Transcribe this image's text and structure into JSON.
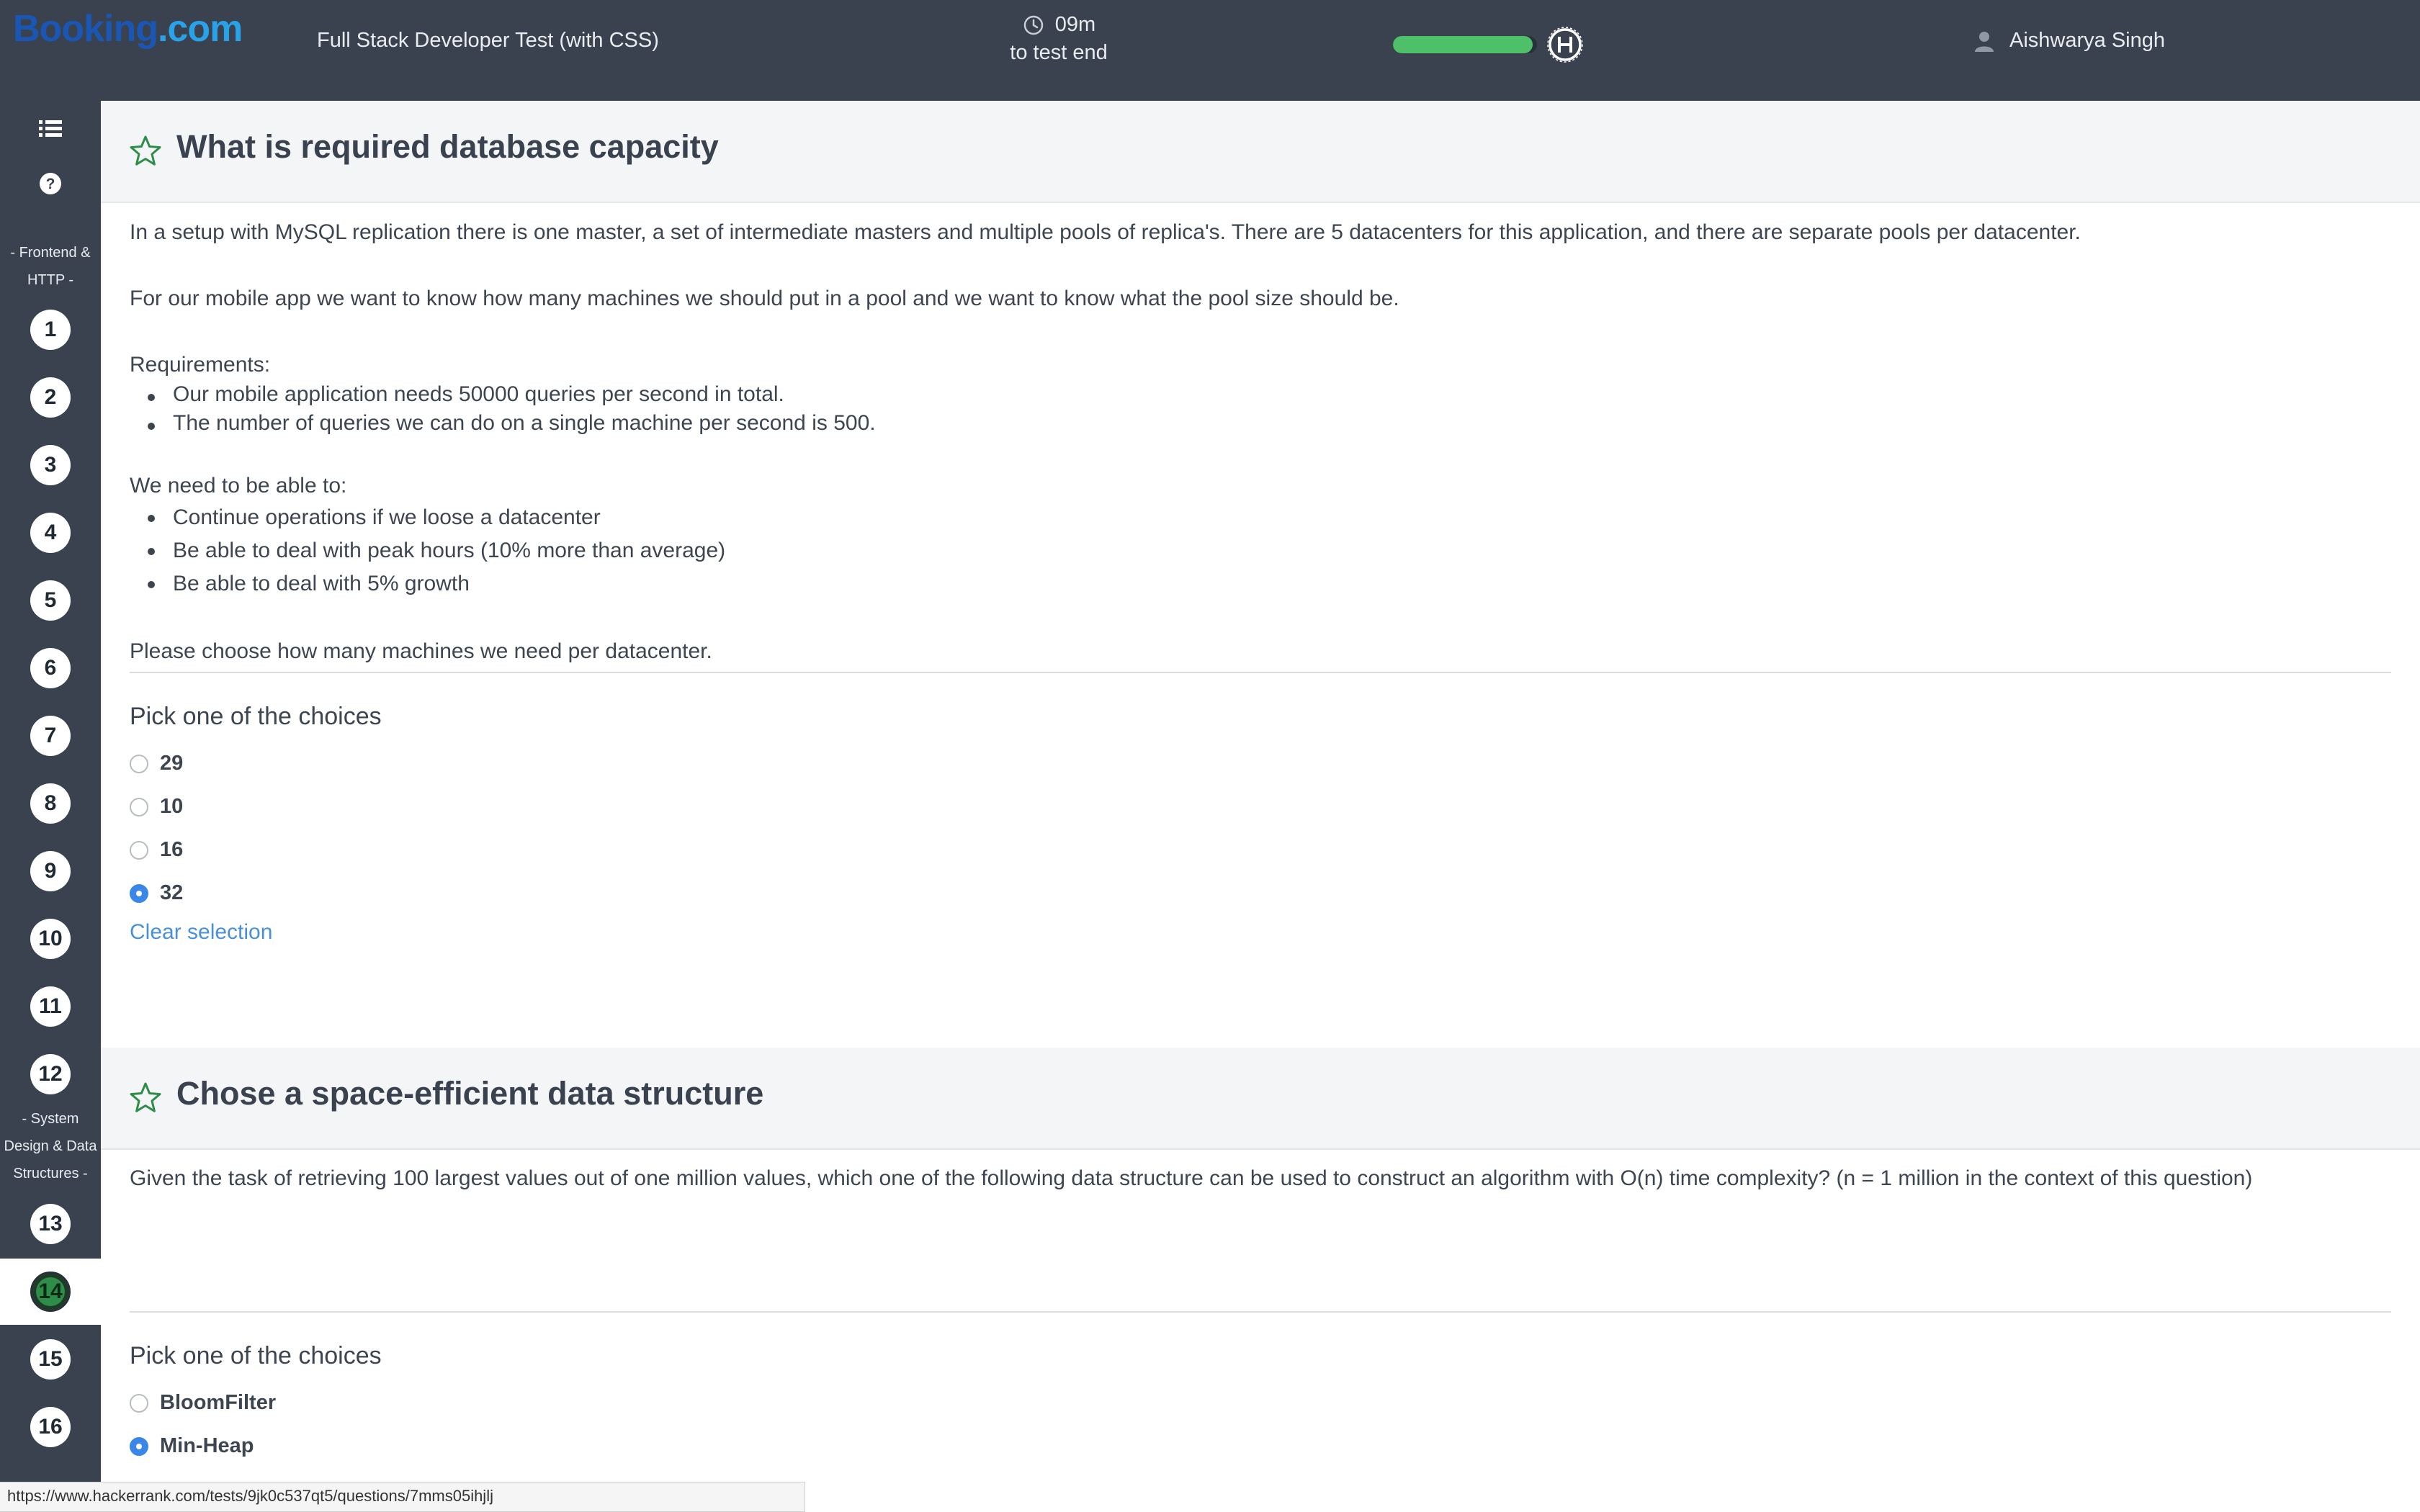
{
  "header": {
    "logo_main": "Booking",
    "logo_tld": ".com",
    "test_title": "Full Stack Developer Test (with CSS)",
    "timer_value": "09m",
    "timer_sub": "to test end",
    "progress_fraction": 0.97,
    "progress_color": "#4fc06a",
    "user_name": "Aishwarya Singh"
  },
  "sidebar": {
    "sections": [
      {
        "label_lines": [
          "- Frontend &",
          "HTTP -"
        ]
      },
      {
        "label_lines": [
          "- System",
          "Design & Data",
          "Structures -"
        ]
      }
    ],
    "questions": [
      "1",
      "2",
      "3",
      "4",
      "5",
      "6",
      "7",
      "8",
      "9",
      "10",
      "11",
      "12",
      "13",
      "14",
      "15",
      "16"
    ],
    "active_question": "14"
  },
  "questions": [
    {
      "title": "What is required database capacity",
      "paragraphs": [
        "In a setup with MySQL replication there is one master, a set of intermediate masters and multiple pools of replica's. There are 5 datacenters for this application, and there are separate pools per datacenter.",
        "For our mobile app we want to know how many machines we should put in a pool and we want to know what the pool size should be."
      ],
      "requirements_heading": "Requirements:",
      "requirements": [
        "Our mobile application needs 50000 queries per second in total.",
        "The number of queries we can do on a single machine per second is 500."
      ],
      "needs_heading": "We need to be able to:",
      "needs": [
        "Continue operations if we loose a datacenter",
        "Be able to deal with peak hours (10% more than average)",
        "Be able to deal with 5% growth"
      ],
      "prompt": "Please choose how many machines we need per datacenter.",
      "pick_label": "Pick one of the choices",
      "choices": [
        "29",
        "10",
        "16",
        "32"
      ],
      "selected": "32",
      "clear_label": "Clear selection"
    },
    {
      "title": "Chose a space-efficient data structure",
      "paragraphs": [
        "Given the task of retrieving 100 largest values out of one million values, which one of the following data structure can be used to construct an algorithm with O(n) time complexity? (n = 1 million in the context of this question)"
      ],
      "pick_label": "Pick one of the choices",
      "choices": [
        "BloomFilter",
        "Min-Heap"
      ],
      "selected": "Min-Heap"
    }
  ],
  "statusbar": {
    "url": "https://www.hackerrank.com/tests/9jk0c537qt5/questions/7mms05ihjlj"
  },
  "icons": {
    "timer": "clock-icon",
    "user": "user-icon",
    "list": "list-icon",
    "help": "help-icon",
    "star": "star-outline-icon",
    "brand": "hackerrank-badge-icon"
  }
}
